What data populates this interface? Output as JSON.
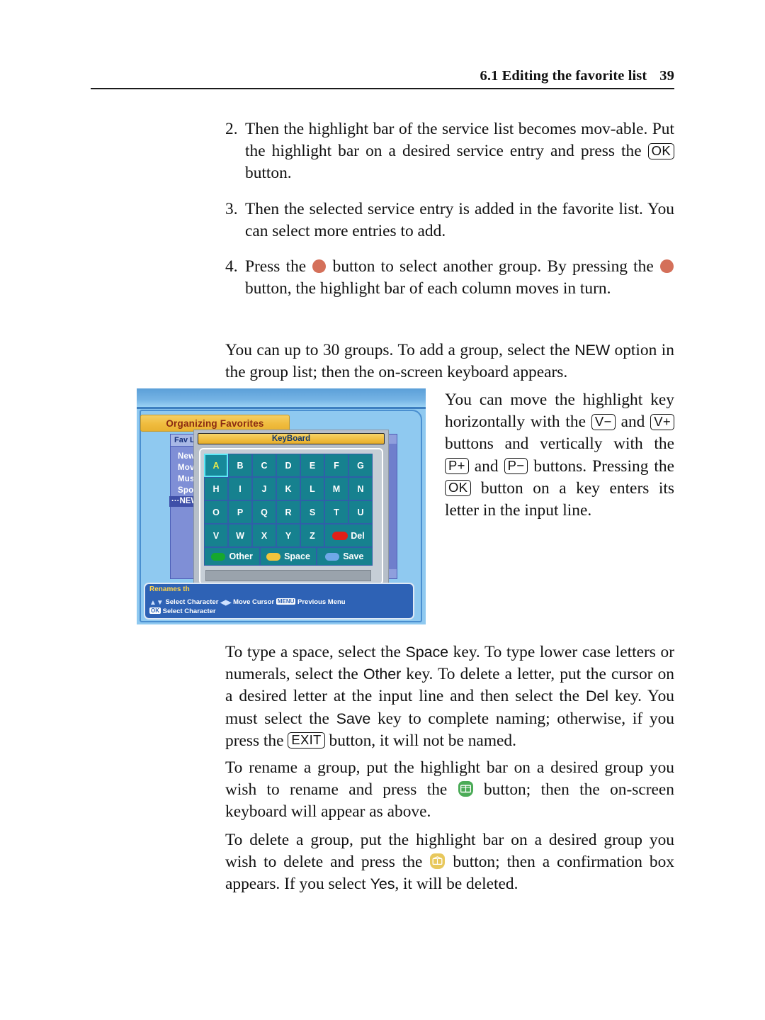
{
  "header": {
    "section": "6.1 Editing the favorite list",
    "page_number": "39"
  },
  "list_items": [
    {
      "number": "2.",
      "text_a": "Then the highlight bar of the service list becomes mov-able. Put the highlight bar on a desired service entry and press the ",
      "keycap": "OK",
      "text_b": " button."
    },
    {
      "number": "3.",
      "text_a": "Then the selected service entry is added in the favorite list. You can select more entries to add."
    },
    {
      "number": "4.",
      "text_a": "Press the ",
      "text_b": " button to select another group. By pressing the ",
      "text_c": " button, the highlight bar of each column moves in turn."
    }
  ],
  "paragraphs": {
    "groups_intro_a": "You can up to 30 groups. To add a group, select the ",
    "groups_intro_new": "NEW",
    "groups_intro_b": " option in the group list; then the on-screen keyboard appears.",
    "nav_a": "You can move the highlight key horizontally with the ",
    "nav_key_vminus": "V−",
    "nav_b": " and ",
    "nav_key_vplus": "V+",
    "nav_c": " buttons and vertically with the ",
    "nav_key_pplus": "P+",
    "nav_d": " and ",
    "nav_key_pminus": "P−",
    "nav_e": " buttons. Pressing the ",
    "nav_key_ok": "OK",
    "nav_f": " button on a key enters its letter in the input line.",
    "typing_a": "To type a space, select the ",
    "typing_space": "Space",
    "typing_b": " key. To type lower case letters or numerals, select the ",
    "typing_other": "Other",
    "typing_c": " key. To delete a letter, put the cursor on a desired letter at the input line and then select the ",
    "typing_del": "Del",
    "typing_d": " key. You must select the ",
    "typing_save": "Save",
    "typing_e": " key to complete naming; otherwise, if you press the ",
    "typing_exit": "EXIT",
    "typing_f": " button, it will not be named.",
    "rename_a": "To rename a group, put the highlight bar on a desired group you wish to rename and press the ",
    "rename_b": " button; then the on-screen keyboard will appear as above.",
    "delete_a": "To delete a group, put the highlight bar on a desired group you wish to delete and press the ",
    "delete_b": " button; then a confirmation box appears. If you select ",
    "delete_yes": "Yes",
    "delete_c": ", it will be deleted."
  },
  "osd": {
    "title": "Organizing Favorites",
    "fav_list_header": "Fav Li",
    "fav_items": [
      "New",
      "Mov",
      "Mus",
      "Spo"
    ],
    "fav_item_selected": "···NEW",
    "keyboard_title": "KeyBoard",
    "keys_row1": [
      "A",
      "B",
      "C",
      "D",
      "E",
      "F",
      "G"
    ],
    "keys_row2": [
      "H",
      "I",
      "J",
      "K",
      "L",
      "M",
      "N"
    ],
    "keys_row3": [
      "O",
      "P",
      "Q",
      "R",
      "S",
      "T",
      "U"
    ],
    "keys_row4": [
      "V",
      "W",
      "X",
      "Y",
      "Z"
    ],
    "key_del": "Del",
    "key_other": "Other",
    "key_space": "Space",
    "key_save": "Save",
    "selected_key": "A",
    "help_line0": "Renames th",
    "help_select_character": "Select Character",
    "help_move_cursor": "Move Cursor",
    "help_menu_chip": "MENU",
    "help_previous_menu": "Previous Menu",
    "help_ok_chip": "OK",
    "help_ok_action": "Select Character"
  },
  "colors": {
    "remote_red_button": "#d4705a",
    "remote_green_button": "#4bab57",
    "remote_gold_button": "#e8c85c",
    "osd_background": "#8fc9f0",
    "osd_title_bar": "#f0bc3e",
    "osd_key_teal": "#16818f",
    "osd_key_selected_border": "#5de8f7"
  }
}
